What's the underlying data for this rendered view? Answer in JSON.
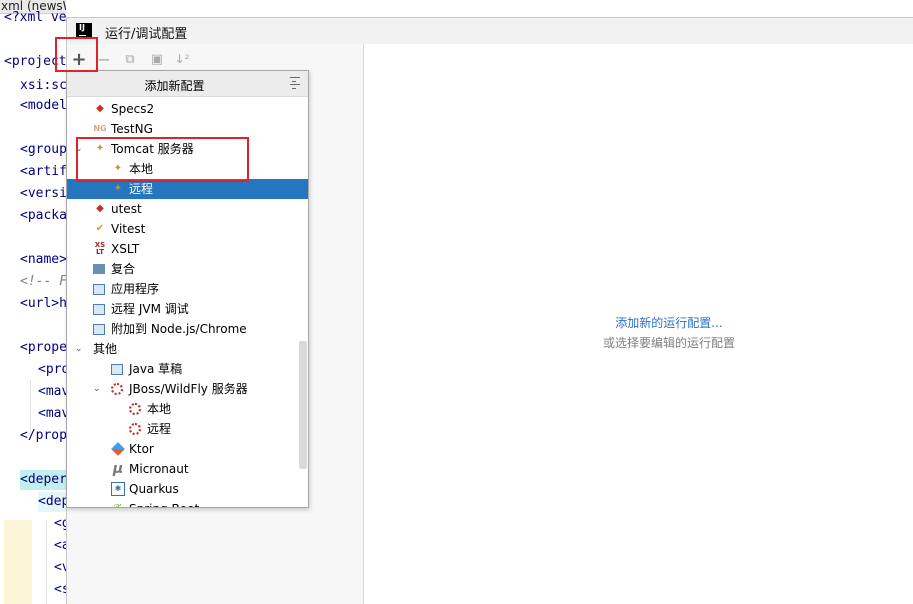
{
  "editor": {
    "tab_title": "xml (newsWeb)",
    "lines": [
      {
        "text": "<?xml ve",
        "kind": "xmldecl"
      },
      {
        "text": "<project",
        "kind": "tag"
      },
      {
        "text": "xsi:sc",
        "kind": "tag"
      },
      {
        "text": "<model",
        "kind": "tag"
      },
      {
        "text": "<group",
        "kind": "tag"
      },
      {
        "text": "<artif",
        "kind": "tag"
      },
      {
        "text": "<versi",
        "kind": "tag"
      },
      {
        "text": "<packa",
        "kind": "tag"
      },
      {
        "text": "<name>",
        "kind": "tag"
      },
      {
        "text": "<!-- F",
        "kind": "comment"
      },
      {
        "text": "<url>h",
        "kind": "tag"
      },
      {
        "text": "<prope",
        "kind": "tag"
      },
      {
        "text": "<pro",
        "kind": "tag"
      },
      {
        "text": "<mav",
        "kind": "tag"
      },
      {
        "text": "<mav",
        "kind": "tag"
      },
      {
        "text": "</prop",
        "kind": "tag"
      },
      {
        "text": "<deper",
        "kind": "tag"
      },
      {
        "text": "<dep",
        "kind": "tag"
      },
      {
        "text": "<g",
        "kind": "tag"
      },
      {
        "text": "<a",
        "kind": "tag"
      },
      {
        "text": "<v",
        "kind": "tag"
      },
      {
        "text": "<s",
        "kind": "tag"
      }
    ]
  },
  "dialog": {
    "title": "运行/调试配置",
    "logo": "IJ",
    "toolbar": {
      "add": "+",
      "remove": "−",
      "copy": "⧉",
      "folder": "▣",
      "sort": "↓²"
    },
    "empty_state": {
      "add_link": "添加新的运行配置...",
      "hint": "或选择要编辑的运行配置"
    }
  },
  "popup": {
    "title": "添加新配置",
    "items": [
      {
        "label": "Specs2",
        "icon": "specs2-icon"
      },
      {
        "label": "TestNG",
        "icon": "testng-icon"
      },
      {
        "label": "Tomcat 服务器",
        "icon": "tomcat-icon",
        "expanded": true
      },
      {
        "label": "本地",
        "icon": "tomcat-local-icon"
      },
      {
        "label": "远程",
        "icon": "tomcat-remote-icon",
        "selected": true
      },
      {
        "label": "utest",
        "icon": "utest-icon"
      },
      {
        "label": "Vitest",
        "icon": "vitest-icon"
      },
      {
        "label": "XSLT",
        "icon": "xslt-icon"
      },
      {
        "label": "复合",
        "icon": "compound-icon"
      },
      {
        "label": "应用程序",
        "icon": "application-icon"
      },
      {
        "label": "远程 JVM 调试",
        "icon": "remote-jvm-icon"
      },
      {
        "label": "附加到 Node.js/Chrome",
        "icon": "attach-node-icon"
      },
      {
        "label": "其他",
        "icon": "",
        "expanded": true
      },
      {
        "label": "Java 草稿",
        "icon": "java-scratch-icon"
      },
      {
        "label": "JBoss/WildFly 服务器",
        "icon": "jboss-icon",
        "expanded": true
      },
      {
        "label": "本地",
        "icon": "jboss-local-icon"
      },
      {
        "label": "远程",
        "icon": "jboss-remote-icon"
      },
      {
        "label": "Ktor",
        "icon": "ktor-icon"
      },
      {
        "label": "Micronaut",
        "icon": "micronaut-icon"
      },
      {
        "label": "Quarkus",
        "icon": "quarkus-icon"
      },
      {
        "label": "Spring Boot",
        "icon": "spring-boot-icon"
      }
    ],
    "glyphs": {
      "chevron": "⌄",
      "specs": "◆",
      "testng": "NG",
      "cat": "✦",
      "vitest": "✔",
      "xslt": "XS\nLT",
      "micronaut": "µ",
      "quarkus": "✱",
      "spring": "❦"
    }
  }
}
